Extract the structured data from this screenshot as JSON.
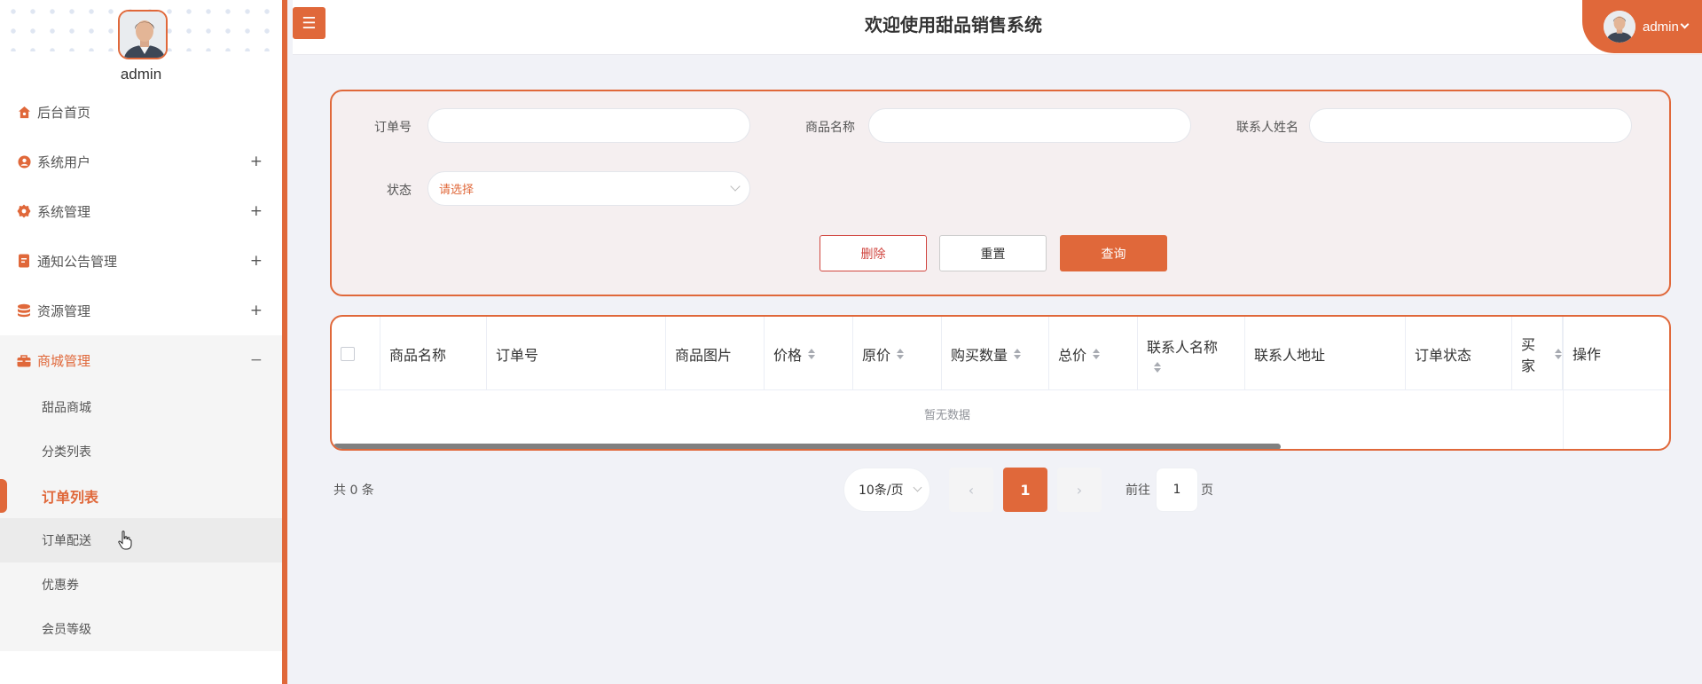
{
  "app": {
    "title": "欢迎使用甜品销售系统"
  },
  "user": {
    "name": "admin"
  },
  "sidebar": {
    "items": [
      {
        "label": "后台首页",
        "icon": "home-icon",
        "expander": ""
      },
      {
        "label": "系统用户",
        "icon": "user-icon",
        "expander": "+"
      },
      {
        "label": "系统管理",
        "icon": "settings-icon",
        "expander": "+"
      },
      {
        "label": "通知公告管理",
        "icon": "notice-icon",
        "expander": "+"
      },
      {
        "label": "资源管理",
        "icon": "database-icon",
        "expander": "+"
      },
      {
        "label": "商城管理",
        "icon": "shop-icon",
        "expander": "−"
      }
    ],
    "sub_items": [
      {
        "label": "甜品商城"
      },
      {
        "label": "分类列表"
      },
      {
        "label": "订单列表"
      },
      {
        "label": "订单配送"
      },
      {
        "label": "优惠券"
      },
      {
        "label": "会员等级"
      }
    ]
  },
  "search": {
    "order_no_label": "订单号",
    "order_no_value": "",
    "goods_name_label": "商品名称",
    "goods_name_value": "",
    "contact_name_label": "联系人姓名",
    "contact_name_value": "",
    "status_label": "状态",
    "status_placeholder": "请选择",
    "delete_label": "删除",
    "reset_label": "重置",
    "query_label": "查询"
  },
  "table": {
    "columns": [
      "商品名称",
      "订单号",
      "商品图片",
      "价格",
      "原价",
      "购买数量",
      "总价",
      "联系人名称",
      "联系人地址",
      "订单状态",
      "买家",
      "操作"
    ],
    "empty_text": "暂无数据"
  },
  "pagination": {
    "total_text": "共 0 条",
    "page_size": "10条/页",
    "prev": "‹",
    "current_page": "1",
    "next": "›",
    "goto_label": "前往",
    "goto_value": "1",
    "page_suffix": "页"
  },
  "colors": {
    "accent": "#e0683a",
    "danger": "#d0453f",
    "background": "#f1f2f7"
  }
}
